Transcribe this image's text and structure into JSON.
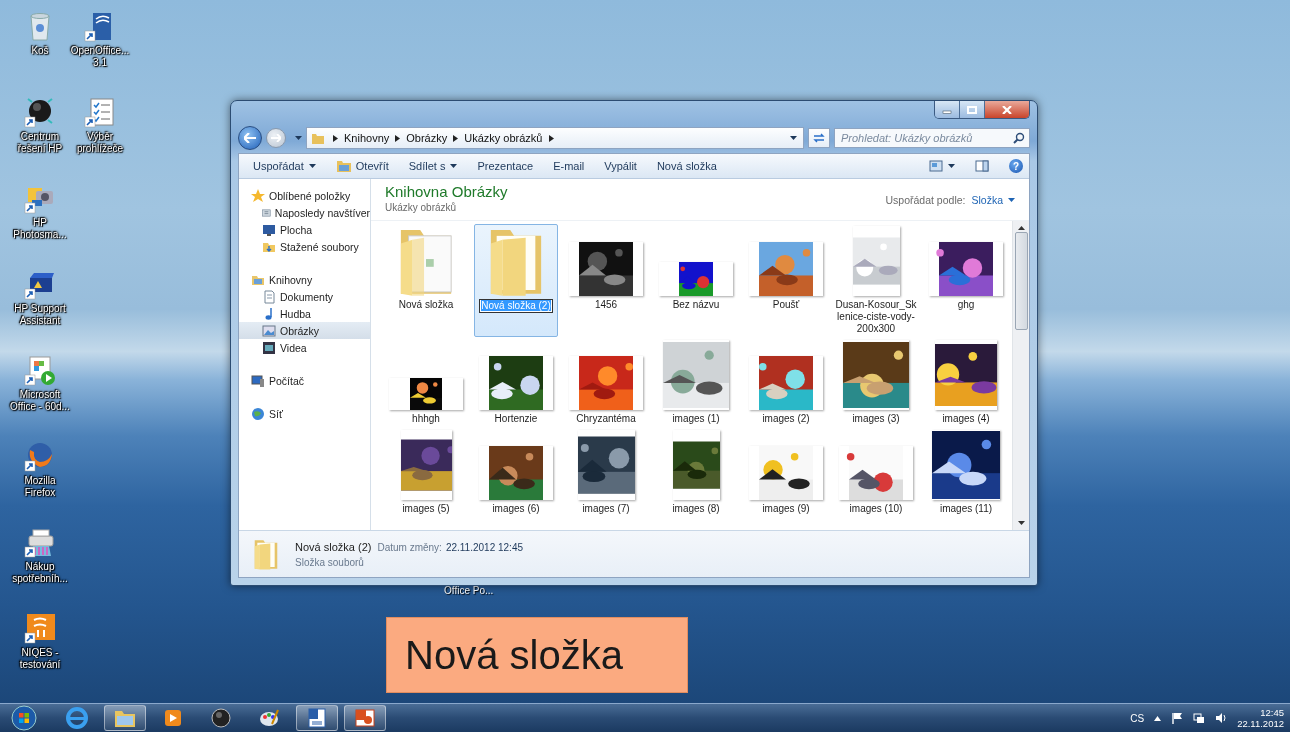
{
  "desktop": {
    "icons": [
      {
        "label": "Koš"
      },
      {
        "label": "OpenOffice... 3.1"
      },
      {
        "label": "Centrum řešení HP"
      },
      {
        "label": "Výběr prohlížeče"
      },
      {
        "label": "HP Photosma..."
      },
      {
        "label": "HP Support Assistant"
      },
      {
        "label": "Microsoft Office - 60d..."
      },
      {
        "label": "Mozilla Firefox"
      },
      {
        "label": "Nákup spotřebníh..."
      },
      {
        "label": "NIQES - testování"
      }
    ],
    "covered_label": "Office Po..."
  },
  "explorer": {
    "breadcrumb": [
      "Knihovny",
      "Obrázky",
      "Ukázky obrázků"
    ],
    "search": {
      "placeholder": "Prohledat: Ukázky obrázků"
    },
    "toolbar": [
      {
        "label": "Uspořádat",
        "kind": "menu"
      },
      {
        "label": "Otevřít",
        "kind": "icon"
      },
      {
        "label": "Sdílet s",
        "kind": "menu"
      },
      {
        "label": "Prezentace",
        "kind": "plain"
      },
      {
        "label": "E-mail",
        "kind": "plain"
      },
      {
        "label": "Vypálit",
        "kind": "plain"
      },
      {
        "label": "Nová složka",
        "kind": "plain"
      }
    ],
    "help": "?",
    "nav_pane": [
      {
        "label": "Oblíbené položky",
        "selected": false,
        "children": [
          {
            "label": "Naposledy navštíver",
            "selected": false
          },
          {
            "label": "Plocha",
            "selected": false
          },
          {
            "label": "Stažené soubory",
            "selected": false
          }
        ]
      },
      {
        "label": "Knihovny",
        "selected": false,
        "children": [
          {
            "label": "Dokumenty",
            "selected": false
          },
          {
            "label": "Hudba",
            "selected": false
          },
          {
            "label": "Obrázky",
            "selected": true
          },
          {
            "label": "Videa",
            "selected": false
          }
        ]
      },
      {
        "label": "Počítač",
        "selected": false
      },
      {
        "label": "Síť",
        "selected": false
      }
    ],
    "library": {
      "title": "Knihovna Obrázky",
      "subtitle": "Ukázky obrázků",
      "arrange_label": "Uspořádat podle:",
      "arrange_value": "Složka"
    },
    "items": [
      {
        "kind": "folder",
        "label": "Nová složka",
        "selected": false,
        "editing": false
      },
      {
        "kind": "folder",
        "label": "Nová složka (2)",
        "selected": true,
        "editing": true
      },
      {
        "kind": "picture",
        "label": "1456",
        "selected": false,
        "editing": false
      },
      {
        "kind": "picture",
        "label": "Bez názvu",
        "selected": false,
        "editing": false
      },
      {
        "kind": "picture",
        "label": "Poušť",
        "selected": false,
        "editing": false
      },
      {
        "kind": "picture",
        "label": "Dusan-Kosour_Sklenice-ciste-vody-200x300",
        "selected": false,
        "editing": false
      },
      {
        "kind": "picture",
        "label": "ghg",
        "selected": false,
        "editing": false
      },
      {
        "kind": "picture",
        "label": "hhhgh",
        "selected": false,
        "editing": false
      },
      {
        "kind": "picture",
        "label": "Hortenzie",
        "selected": false,
        "editing": false
      },
      {
        "kind": "picture",
        "label": "Chryzantéma",
        "selected": false,
        "editing": false
      },
      {
        "kind": "picture",
        "label": "images (1)",
        "selected": false,
        "editing": false
      },
      {
        "kind": "picture",
        "label": "images (2)",
        "selected": false,
        "editing": false
      },
      {
        "kind": "picture",
        "label": "images (3)",
        "selected": false,
        "editing": false
      },
      {
        "kind": "picture",
        "label": "images (4)",
        "selected": false,
        "editing": false
      },
      {
        "kind": "picture",
        "label": "images (5)",
        "selected": false,
        "editing": false
      },
      {
        "kind": "picture",
        "label": "images (6)",
        "selected": false,
        "editing": false
      },
      {
        "kind": "picture",
        "label": "images (7)",
        "selected": false,
        "editing": false
      },
      {
        "kind": "picture",
        "label": "images (8)",
        "selected": false,
        "editing": false
      },
      {
        "kind": "picture",
        "label": "images (9)",
        "selected": false,
        "editing": false
      },
      {
        "kind": "picture",
        "label": "images (10)",
        "selected": false,
        "editing": false
      },
      {
        "kind": "picture",
        "label": "images (11)",
        "selected": false,
        "editing": false
      }
    ],
    "details": {
      "name": "Nová složka (2)",
      "date_label": "Datum změny:",
      "date": "22.11.2012 12:45",
      "type": "Složka souborů"
    }
  },
  "caption": "Nová složka",
  "taskbar": {
    "apps": [
      {
        "running": false
      },
      {
        "running": true
      },
      {
        "running": false
      },
      {
        "running": false
      },
      {
        "running": false
      },
      {
        "running": true
      },
      {
        "running": true
      }
    ],
    "tray": {
      "language": "CS",
      "time": "12:45",
      "date": "22.11.2012"
    }
  }
}
